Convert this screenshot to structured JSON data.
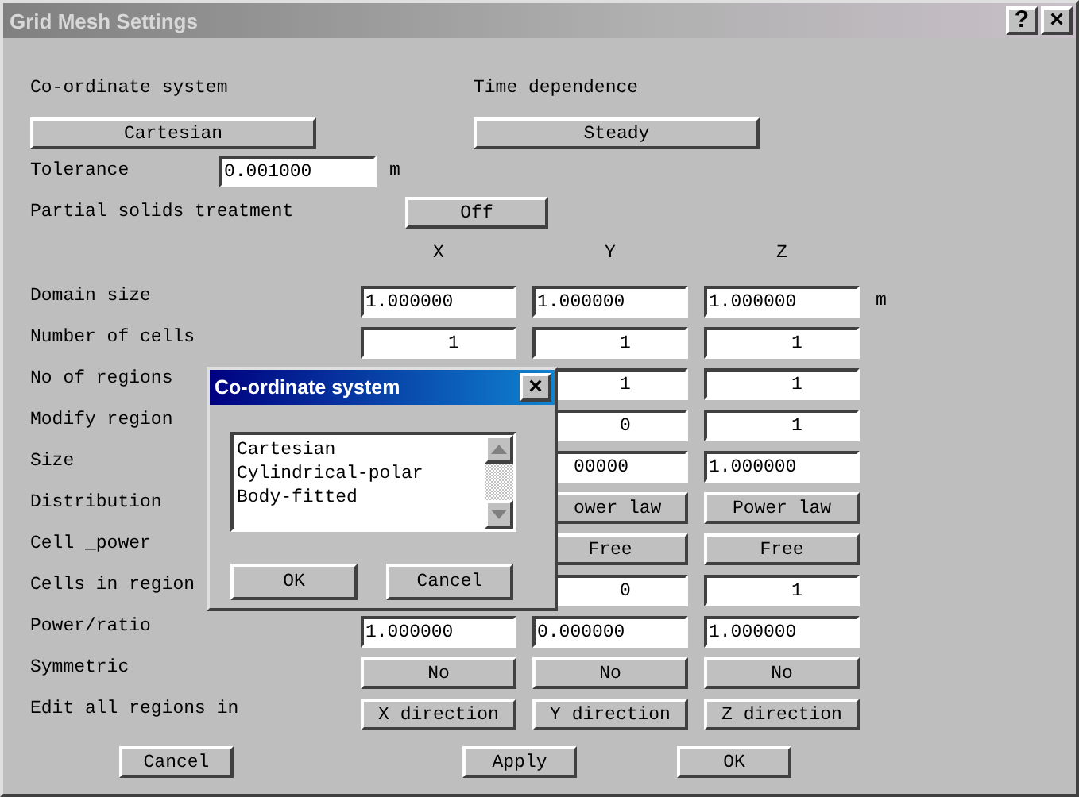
{
  "window": {
    "title": "Grid Mesh Settings",
    "help_button": "?",
    "close_button": "×"
  },
  "coordinate_system": {
    "label": "Co-ordinate system",
    "value": "Cartesian"
  },
  "time_dependence": {
    "label": "Time dependence",
    "value": "Steady"
  },
  "tolerance": {
    "label": "Tolerance",
    "value": "0.001000",
    "unit": "m"
  },
  "partial_solids": {
    "label": "Partial solids treatment",
    "value": "Off"
  },
  "columns": [
    "X",
    "Y",
    "Z"
  ],
  "rows": [
    {
      "label": "Domain size",
      "unit": "m",
      "cells": [
        {
          "kind": "text",
          "value": "1.000000"
        },
        {
          "kind": "text",
          "value": "1.000000"
        },
        {
          "kind": "text",
          "value": "1.000000"
        }
      ]
    },
    {
      "label": "Number of cells",
      "cells": [
        {
          "kind": "count",
          "value": "1"
        },
        {
          "kind": "count",
          "value": "1"
        },
        {
          "kind": "count",
          "value": "1"
        }
      ]
    },
    {
      "label": "No of regions",
      "cells": [
        null,
        {
          "kind": "count",
          "value": "1"
        },
        {
          "kind": "count",
          "value": "1"
        }
      ]
    },
    {
      "label": "Modify region",
      "cells": [
        null,
        {
          "kind": "count",
          "value": "0"
        },
        {
          "kind": "count",
          "value": "1"
        }
      ]
    },
    {
      "label": "Size",
      "cells": [
        null,
        {
          "kind": "text",
          "value": "00000",
          "partly_hidden": true
        },
        {
          "kind": "text",
          "value": "1.000000"
        }
      ]
    },
    {
      "label": "Distribution",
      "cells": [
        null,
        {
          "kind": "button",
          "value": "ower law",
          "partly_hidden": true
        },
        {
          "kind": "button",
          "value": "Power law"
        }
      ]
    },
    {
      "label": "Cell _power",
      "cells": [
        null,
        {
          "kind": "button",
          "value": "Free"
        },
        {
          "kind": "button",
          "value": "Free"
        }
      ]
    },
    {
      "label": "Cells in region",
      "cells": [
        null,
        {
          "kind": "count",
          "value": "0"
        },
        {
          "kind": "count",
          "value": "1"
        }
      ]
    },
    {
      "label": "Power/ratio",
      "cells": [
        {
          "kind": "text",
          "value": "1.000000"
        },
        {
          "kind": "text",
          "value": "0.000000"
        },
        {
          "kind": "text",
          "value": "1.000000"
        }
      ]
    },
    {
      "label": "Symmetric",
      "cells": [
        {
          "kind": "button",
          "value": "No"
        },
        {
          "kind": "button",
          "value": "No"
        },
        {
          "kind": "button",
          "value": "No"
        }
      ]
    },
    {
      "label": "Edit all regions in",
      "cells": [
        {
          "kind": "button",
          "value": "X direction"
        },
        {
          "kind": "button",
          "value": "Y direction"
        },
        {
          "kind": "button",
          "value": "Z direction"
        }
      ]
    }
  ],
  "buttons": [
    "Cancel",
    "Apply",
    "OK"
  ],
  "dialog": {
    "title": "Co-ordinate system",
    "close_button": "×",
    "options": [
      "Cartesian",
      "Cylindrical-polar",
      "Body-fitted"
    ],
    "buttons": [
      "OK",
      "Cancel"
    ]
  }
}
